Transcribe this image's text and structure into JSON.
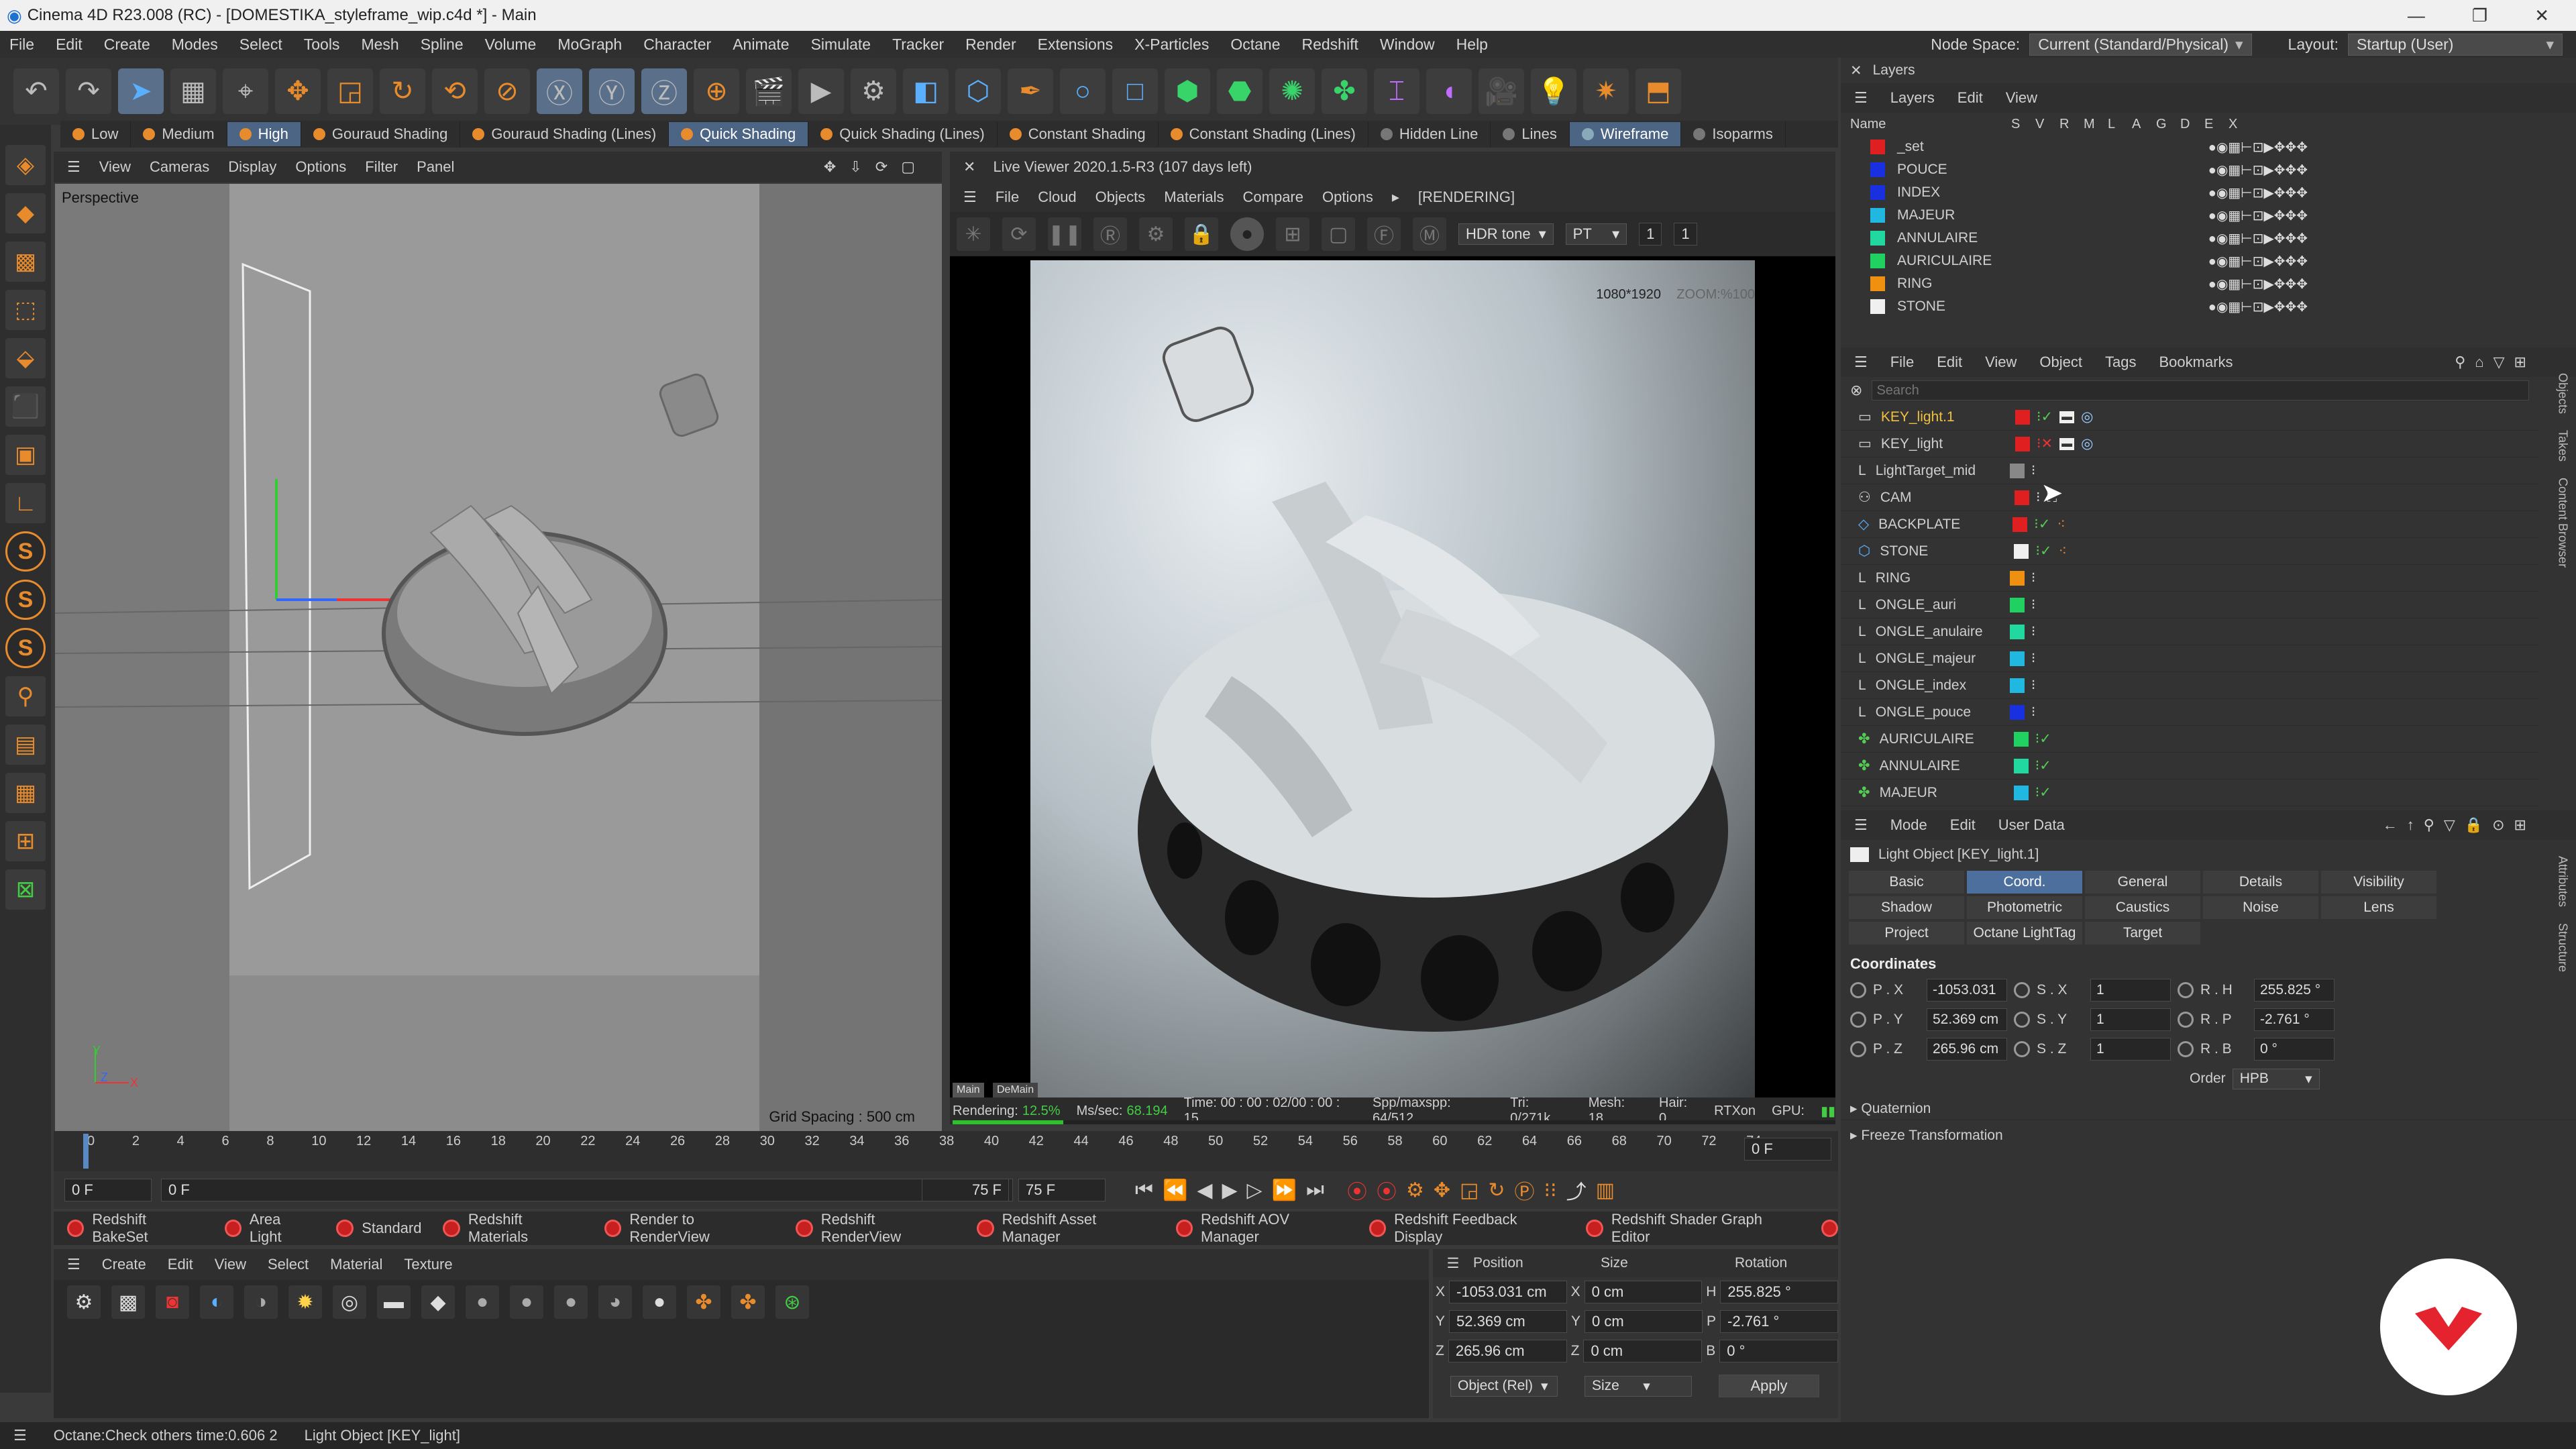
{
  "window": {
    "title": "Cinema 4D R23.008 (RC) - [DOMESTIKA_styleframe_wip.c4d *] - Main",
    "controls": [
      "—",
      "❐",
      "✕"
    ]
  },
  "menubar": {
    "items": [
      "File",
      "Edit",
      "Create",
      "Modes",
      "Select",
      "Tools",
      "Mesh",
      "Spline",
      "Volume",
      "MoGraph",
      "Character",
      "Animate",
      "Simulate",
      "Tracker",
      "Render",
      "Extensions",
      "X-Particles",
      "Octane",
      "Redshift",
      "Window",
      "Help"
    ],
    "node_space_label": "Node Space:",
    "node_space_value": "Current (Standard/Physical)",
    "layout_label": "Layout:",
    "layout_value": "Startup (User)"
  },
  "shading": {
    "items": [
      "Low",
      "Medium",
      "High",
      "Gouraud Shading",
      "Gouraud Shading (Lines)",
      "Quick Shading",
      "Quick Shading (Lines)",
      "Constant Shading",
      "Constant Shading (Lines)",
      "Hidden Line",
      "Lines",
      "Wireframe",
      "Isoparms"
    ],
    "active": [
      "High",
      "Quick Shading",
      "Wireframe"
    ]
  },
  "viewport": {
    "menu": [
      "View",
      "Cameras",
      "Display",
      "Options",
      "Filter",
      "Panel"
    ],
    "label": "Perspective",
    "grid_spacing": "Grid Spacing : 500 cm",
    "axis_y": "Y",
    "axis_x": "X",
    "axis_z": "Z"
  },
  "liveviewer": {
    "title": "Live Viewer 2020.1.5-R3 (107 days left)",
    "menu": [
      "File",
      "Cloud",
      "Objects",
      "Materials",
      "Compare",
      "Options"
    ],
    "rendering_tag": "[RENDERING]",
    "tonemap": "HDR tone",
    "kernel": "PT",
    "val1": "1",
    "val2": "1",
    "resolution": "1080*1920",
    "zoom": "ZOOM:%100",
    "tab_main": "Main",
    "tab_demain": "DeMain",
    "status": {
      "rendering": "Rendering:",
      "rendering_pct": "12.5%",
      "mssec": "Ms/sec:",
      "mssec_val": "68.194",
      "time": "Time: 00 : 00 : 02/00 : 00 : 15",
      "spp": "Spp/maxspp: 64/512",
      "tri": "Tri: 0/271k",
      "mesh": "Mesh: 18",
      "hair": "Hair: 0",
      "rtx": "RTXon",
      "gpu": "GPU:"
    },
    "progress": 0.125
  },
  "timeline": {
    "ticks": [
      "0",
      "2",
      "4",
      "6",
      "8",
      "10",
      "12",
      "14",
      "16",
      "18",
      "20",
      "22",
      "24",
      "26",
      "28",
      "30",
      "32",
      "34",
      "36",
      "38",
      "40",
      "42",
      "44",
      "46",
      "48",
      "50",
      "52",
      "54",
      "56",
      "58",
      "60",
      "62",
      "64",
      "66",
      "68",
      "70",
      "72",
      "74"
    ],
    "current_frame": "0 F",
    "start": "0 F",
    "start2": "0 F",
    "end": "75 F",
    "end2": "75 F"
  },
  "redshift_bar": [
    "Redshift BakeSet",
    "Area Light",
    "Standard",
    "Redshift Materials",
    "Render to RenderView",
    "Redshift RenderView",
    "Redshift Asset Manager",
    "Redshift AOV Manager",
    "Redshift Feedback Display",
    "Redshift Shader Graph Editor"
  ],
  "material": {
    "menu": [
      "Create",
      "Edit",
      "View",
      "Select",
      "Material",
      "Texture"
    ]
  },
  "coords": {
    "headers": [
      "Position",
      "Size",
      "Rotation"
    ],
    "rows": [
      {
        "axis": "X",
        "pos": "-1053.031 cm",
        "size_axis": "X",
        "size": "0 cm",
        "rot_axis": "H",
        "rot": "255.825 °"
      },
      {
        "axis": "Y",
        "pos": "52.369 cm",
        "size_axis": "Y",
        "size": "0 cm",
        "rot_axis": "P",
        "rot": "-2.761 °"
      },
      {
        "axis": "Z",
        "pos": "265.96 cm",
        "size_axis": "Z",
        "size": "0 cm",
        "rot_axis": "B",
        "rot": "0 °"
      }
    ],
    "mode": "Object (Rel)",
    "size_mode": "Size",
    "apply": "Apply"
  },
  "status": {
    "left": "Octane:Check others time:0.606  2",
    "right": "Light Object [KEY_light]"
  },
  "layers": {
    "title": "Layers",
    "menu": [
      "Layers",
      "Edit",
      "View"
    ],
    "columns": [
      "Name",
      "S",
      "V",
      "R",
      "M",
      "L",
      "A",
      "G",
      "D",
      "E",
      "X"
    ],
    "rows": [
      {
        "name": "_set",
        "color": "#e02020"
      },
      {
        "name": "POUCE",
        "color": "#1830e0"
      },
      {
        "name": "INDEX",
        "color": "#1830e0"
      },
      {
        "name": "MAJEUR",
        "color": "#20b8e0"
      },
      {
        "name": "ANNULAIRE",
        "color": "#20d8a0"
      },
      {
        "name": "AURICULAIRE",
        "color": "#20d060"
      },
      {
        "name": "RING",
        "color": "#f09010"
      },
      {
        "name": "STONE",
        "color": "#f0f0f0"
      }
    ]
  },
  "objects": {
    "menu": [
      "File",
      "Edit",
      "View",
      "Object",
      "Tags",
      "Bookmarks"
    ],
    "search_placeholder": "Search",
    "rows": [
      {
        "name": "KEY_light.1",
        "color": "#e02020",
        "highlight": true
      },
      {
        "name": "KEY_light",
        "color": "#e02020"
      },
      {
        "name": "LightTarget_mid",
        "color": "#888888"
      },
      {
        "name": "CAM",
        "color": "#e02020"
      },
      {
        "name": "BACKPLATE",
        "color": "#e02020"
      },
      {
        "name": "STONE",
        "color": "#f0f0f0"
      },
      {
        "name": "RING",
        "color": "#f09010"
      },
      {
        "name": "ONGLE_auri",
        "color": "#20d060"
      },
      {
        "name": "ONGLE_anulaire",
        "color": "#20d8a0"
      },
      {
        "name": "ONGLE_majeur",
        "color": "#20b8e0"
      },
      {
        "name": "ONGLE_index",
        "color": "#20b8e0"
      },
      {
        "name": "ONGLE_pouce",
        "color": "#1830e0"
      },
      {
        "name": "AURICULAIRE",
        "color": "#20d060"
      },
      {
        "name": "ANNULAIRE",
        "color": "#20d8a0"
      },
      {
        "name": "MAJEUR",
        "color": "#20b8e0"
      }
    ]
  },
  "side_tabs": {
    "right": [
      "Objects",
      "Takes",
      "Content Browser"
    ],
    "right2": [
      "Attributes",
      "Structure"
    ]
  },
  "attributes": {
    "menu": [
      "Mode",
      "Edit",
      "User Data"
    ],
    "object_label": "Light Object [KEY_light.1]",
    "tabs_row1": [
      "Basic",
      "Coord.",
      "General",
      "Details",
      "Visibility"
    ],
    "tabs_row2": [
      "Shadow",
      "Photometric",
      "Caustics",
      "Noise",
      "Lens"
    ],
    "tabs_row3": [
      "Project",
      "Octane LightTag",
      "Target"
    ],
    "active_tab": "Coord.",
    "section": "Coordinates",
    "coord_rows": [
      {
        "p": "P . X",
        "pv": "-1053.031",
        "s": "S . X",
        "sv": "1",
        "r": "R . H",
        "rv": "255.825 °"
      },
      {
        "p": "P . Y",
        "pv": "52.369 cm",
        "s": "S . Y",
        "sv": "1",
        "r": "R . P",
        "rv": "-2.761 °"
      },
      {
        "p": "P . Z",
        "pv": "265.96 cm",
        "s": "S . Z",
        "sv": "1",
        "r": "R . B",
        "rv": "0 °"
      }
    ],
    "order_label": "Order",
    "order_value": "HPB",
    "quaternion": "Quaternion",
    "freeze": "Freeze Transformation"
  }
}
